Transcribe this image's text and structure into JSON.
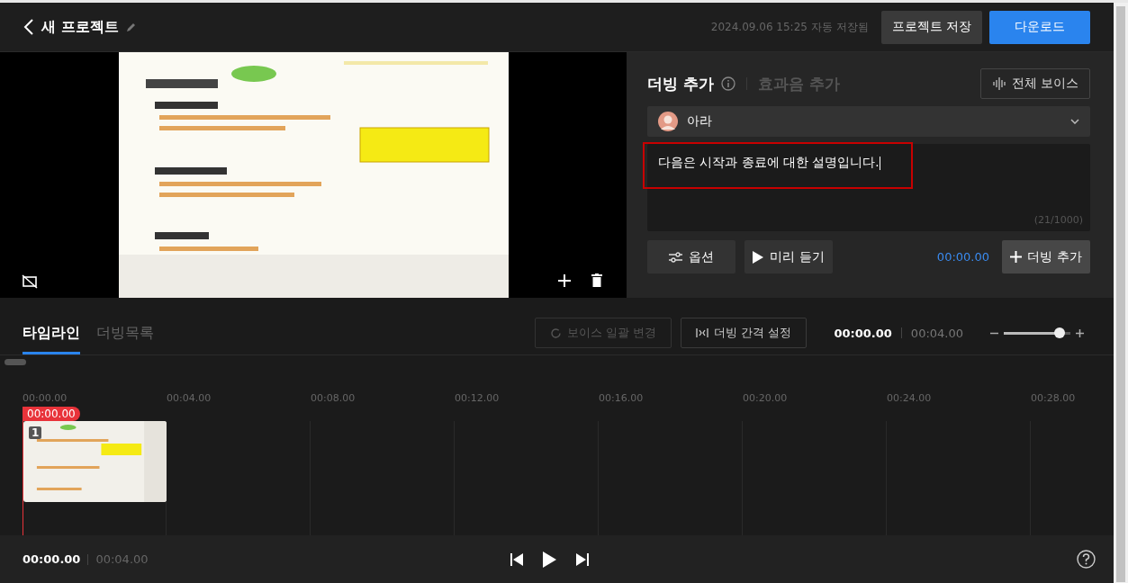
{
  "header": {
    "title": "새 프로젝트",
    "autosave": "2024.09.06 15:25 자동 저장됨",
    "save_button": "프로젝트 저장",
    "download_button": "다운로드"
  },
  "dubbing_panel": {
    "tabs": [
      {
        "label": "더빙 추가",
        "selected": true
      },
      {
        "label": "효과음 추가",
        "selected": false
      }
    ],
    "voice_button": "전체 보이스",
    "voice": {
      "name": "아라"
    },
    "script": {
      "value": "다음은 시작과 종료에 대한 설명입니다.",
      "counter": "(21/1000)",
      "highlighted": true
    },
    "options_button": "옵션",
    "listen_button": "미리 듣기",
    "time": "00:00.00",
    "add_button": "더빙 추가"
  },
  "timeline": {
    "tabs": [
      {
        "label": "타임라인",
        "selected": true
      },
      {
        "label": "더빙목록",
        "selected": false
      }
    ],
    "buttons": [
      {
        "label": "보이스 일괄 변경",
        "kind": "batch",
        "disabled": true
      },
      {
        "label": "더빙 간격 설정",
        "kind": "interval",
        "disabled": false
      }
    ],
    "current": "00:00.00",
    "total": "00:04.00",
    "zoom": {
      "level": 0.84
    },
    "ticks": [
      "00:00.00",
      "00:04.00",
      "00:08.00",
      "00:12.00",
      "00:16.00",
      "00:20.00",
      "00:24.00",
      "00:28.00"
    ],
    "playhead": "00:00.00",
    "clips": [
      {
        "number": "1",
        "kind": "picture"
      }
    ]
  },
  "player": {
    "current": "00:00.00",
    "total": "00:04.00"
  }
}
